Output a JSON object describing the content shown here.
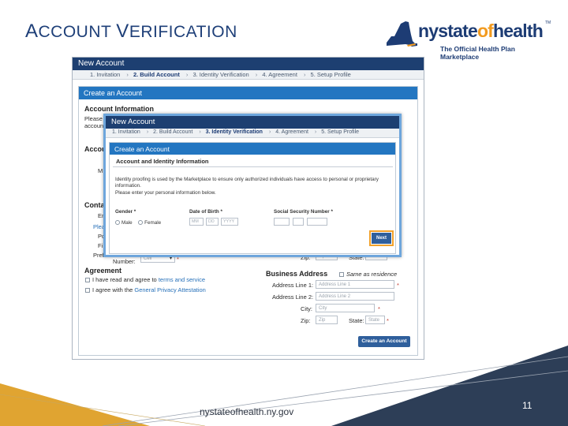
{
  "slide": {
    "title_part1_cap": "A",
    "title_part1_rest": "CCOUNT ",
    "title_part2_cap": "V",
    "title_part2_rest": "ERIFICATION",
    "footer_url": "nystateofhealth.ny.gov",
    "page_number": "11"
  },
  "logo": {
    "word_ny": "nystate",
    "word_of": "of",
    "word_health": "health",
    "tagline": "The Official Health Plan Marketplace",
    "tm": "TM"
  },
  "background": {
    "header": "New Account",
    "steps": [
      "1. Invitation",
      "2. Build Account",
      "3. Identity Verification",
      "4. Agreement",
      "5. Setup Profile"
    ],
    "active_step": "2. Build Account",
    "panel_title": "Create an Account",
    "account_info": "Account Information",
    "please_prefix": "Please",
    "account_prefix": "account",
    "account_trunc": "Accou",
    "m_trunc": "M",
    "contact_trunc": "Contac",
    "em_trunc": "Em",
    "please_link_trunc": "Pleas",
    "po_trunc": "Po",
    "fi_trunc": "Fi",
    "preferred_phone": "Preferred Phone",
    "number_label": "Number:",
    "phone_value": "Cell",
    "zip_label_top": "Zip:",
    "zip_value_top": "Zip",
    "state_label_top": "State:",
    "state_value_top": "State",
    "agreement": "Agreement",
    "agree_text_1": "I have read and agree to",
    "agree_link_1": "terms and service",
    "agree_text_2": "I agree with the",
    "agree_link_2": "General Privacy Attestation",
    "business_address": "Business Address",
    "same_as_residence": "Same as residence",
    "address_line_1_label": "Address Line 1:",
    "address_line_1_placeholder": "Address Line 1",
    "address_line_2_label": "Address Line 2:",
    "address_line_2_placeholder": "Address Line 2",
    "city_label": "City:",
    "city_placeholder": "City",
    "zip_label": "Zip:",
    "zip_placeholder": "Zip",
    "state_label": "State:",
    "state_placeholder": "State",
    "create_button": "Create an Account"
  },
  "overlay": {
    "header": "New Account",
    "steps": [
      "1. Invitation",
      "2. Build Account",
      "3. Identity Verification",
      "4. Agreement",
      "5. Setup Profile"
    ],
    "active_step": "3. Identity Verification",
    "panel_title": "Create an Account",
    "section_title": "Account and Identity Information",
    "description_line1": "Identity proofing is used by the Marketplace to ensure only authorized individuals have access to personal or proprietary",
    "description_line2": "information.",
    "description_line3": "Please enter your personal information below.",
    "gender_label": "Gender *",
    "male": "Male",
    "female": "Female",
    "dob_label": "Date of Birth *",
    "dob_mm": "MM",
    "dob_dd": "DD",
    "dob_yyyy": "YYYY",
    "ssn_label": "Social Security Number *",
    "next_button": "Next"
  },
  "colors": {
    "title_blue": "#1e3f78",
    "header_navy": "#1d3f71",
    "panel_blue": "#2376c1",
    "accent_orange": "#f29a1e",
    "footer_navy": "#2d3e57",
    "footer_gold": "#e0a431"
  }
}
